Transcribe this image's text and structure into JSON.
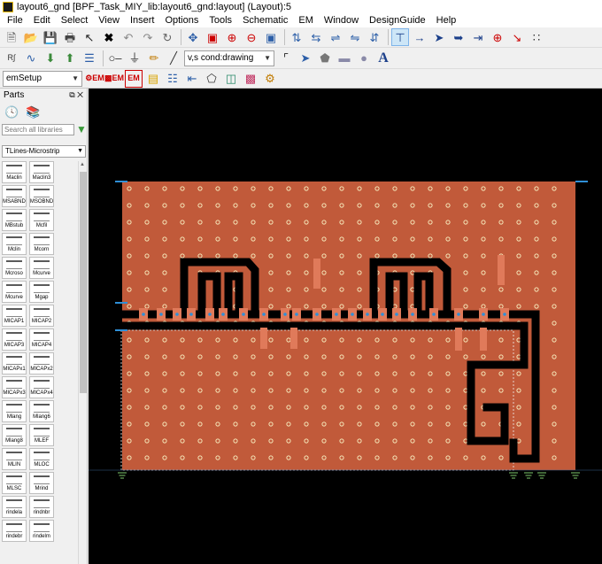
{
  "window": {
    "title": "layout6_gnd [BPF_Task_MIY_lib:layout6_gnd:layout] (Layout):5"
  },
  "menu": {
    "items": [
      "File",
      "Edit",
      "Select",
      "View",
      "Insert",
      "Options",
      "Tools",
      "Schematic",
      "EM",
      "Window",
      "DesignGuide",
      "Help"
    ]
  },
  "toolbar1": {
    "icons": [
      "new-icon",
      "open-icon",
      "save-icon",
      "print-icon",
      "select-arrow-icon",
      "delete-icon",
      "undo-icon",
      "redo-icon",
      "rotate-icon",
      "move-icon",
      "zoom-box-icon",
      "zoom-in-icon",
      "zoom-out-icon",
      "zoom-fit-icon",
      "align-icon",
      "align-center-icon",
      "mirror-icon",
      "flip-icon",
      "distribute-icon",
      "snap-icon",
      "snap-pin-icon",
      "snap-vertex-icon",
      "snap-edge-icon",
      "snap-arrow-icon",
      "snap-center-icon",
      "snap-intersect-icon",
      "grid-snap-icon"
    ]
  },
  "toolbar2": {
    "layer_value": "v,s cond:drawing",
    "icons": [
      "port-icon",
      "ground-icon",
      "pencil-icon",
      "wire-icon",
      "arrow-shape-icon",
      "polygon-icon",
      "rectangle-icon",
      "circle-icon",
      "text-icon"
    ]
  },
  "toolbar3": {
    "em_setup_value": "emSetup",
    "icons": [
      "em-simulate-icon",
      "em-view-icon",
      "em-setup-icon",
      "substrate-icon",
      "component-icon",
      "port-editor-icon",
      "box-3d-icon",
      "preview-3d-icon",
      "color-map-icon",
      "settings-icon"
    ]
  },
  "parts_panel": {
    "title": "Parts",
    "search_placeholder": "Search all libraries",
    "library": "TLines-Microstrip",
    "components": [
      "Maclin",
      "Maclin3",
      "MSABND",
      "MSOBND",
      "MBstub",
      "Mcfil",
      "Mclin",
      "Mcorn",
      "Mcroso",
      "Mcurve",
      "Mcurve",
      "Mgap",
      "MICAP1",
      "MICAP2",
      "MICAP3",
      "MICAP4",
      "MICAPx1",
      "MICAPx2",
      "MICAPx3",
      "MICAPx4",
      "Mlang",
      "Mlang6",
      "Mlang8",
      "MLEF",
      "MLIN",
      "MLOC",
      "MLSC",
      "Mrind",
      "rindela",
      "rindnbr",
      "rindebr",
      "rindelm"
    ]
  },
  "layout": {
    "board_color": "#c15a3a",
    "conductor_color": "#000000",
    "resonator_color": "#e07a5a",
    "via_color": "#f5e6b8",
    "pin_color": "#2f8fd6"
  }
}
